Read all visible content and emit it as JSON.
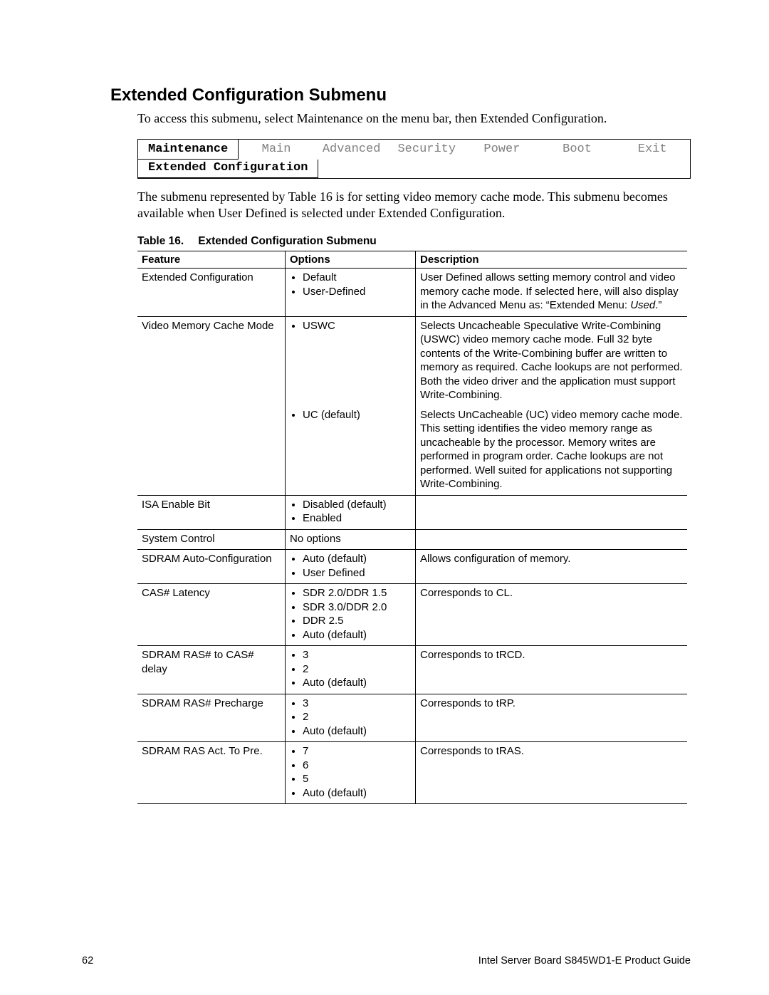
{
  "heading": "Extended Configuration Submenu",
  "intro": "To access this submenu, select Maintenance on the menu bar, then Extended Configuration.",
  "menubar": {
    "active": "Maintenance",
    "items": [
      "Main",
      "Advanced",
      "Security",
      "Power",
      "Boot",
      "Exit"
    ],
    "submenu": "Extended Configuration"
  },
  "para": "The submenu represented by Table 16 is for setting video memory cache mode.  This submenu becomes available when User Defined is selected under Extended Configuration.",
  "table_caption_prefix": "Table 16.",
  "table_caption_title": "Extended Configuration Submenu",
  "columns": {
    "feature": "Feature",
    "options": "Options",
    "description": "Description"
  },
  "rows": [
    {
      "feature": "Extended Configuration",
      "options": [
        "Default",
        "User-Defined"
      ],
      "description": "User Defined allows setting memory control and video memory cache mode.  If selected here, will also display in the Advanced Menu as:  “Extended Menu:  Used.”"
    },
    {
      "feature": "Video Memory Cache Mode",
      "subrows": [
        {
          "options": [
            "USWC"
          ],
          "description": "Selects Uncacheable Speculative Write-Combining (USWC) video memory cache mode.  Full 32 byte contents of the Write-Combining buffer are written to memory as required.  Cache lookups are not performed.  Both the video driver and the application must support Write-Combining."
        },
        {
          "options": [
            "UC (default)"
          ],
          "description": "Selects UnCacheable (UC) video memory cache mode.  This setting identifies the video memory range as uncacheable by the processor.  Memory writes are performed in program order.  Cache lookups are not performed.  Well suited for applications not supporting Write-Combining."
        }
      ]
    },
    {
      "feature": "ISA Enable Bit",
      "options": [
        "Disabled (default)",
        "Enabled"
      ],
      "description": ""
    },
    {
      "feature": "System Control",
      "options_text": "No options",
      "description": ""
    },
    {
      "feature": "SDRAM Auto-Configuration",
      "options": [
        "Auto (default)",
        "User Defined"
      ],
      "description": "Allows configuration of memory."
    },
    {
      "feature": "CAS# Latency",
      "options": [
        "SDR 2.0/DDR 1.5",
        "SDR 3.0/DDR 2.0",
        "DDR 2.5",
        "Auto (default)"
      ],
      "description": "Corresponds to CL."
    },
    {
      "feature": "SDRAM RAS# to CAS# delay",
      "options": [
        "3",
        "2",
        "Auto (default)"
      ],
      "description": "Corresponds to tRCD."
    },
    {
      "feature": "SDRAM RAS# Precharge",
      "options": [
        "3",
        "2",
        "Auto (default)"
      ],
      "description": "Corresponds to tRP."
    },
    {
      "feature": "SDRAM RAS Act. To Pre.",
      "options": [
        "7",
        "6",
        "5",
        "Auto (default)"
      ],
      "description": "Corresponds to tRAS."
    }
  ],
  "footer": {
    "page": "62",
    "title": "Intel Server Board S845WD1-E Product Guide"
  }
}
